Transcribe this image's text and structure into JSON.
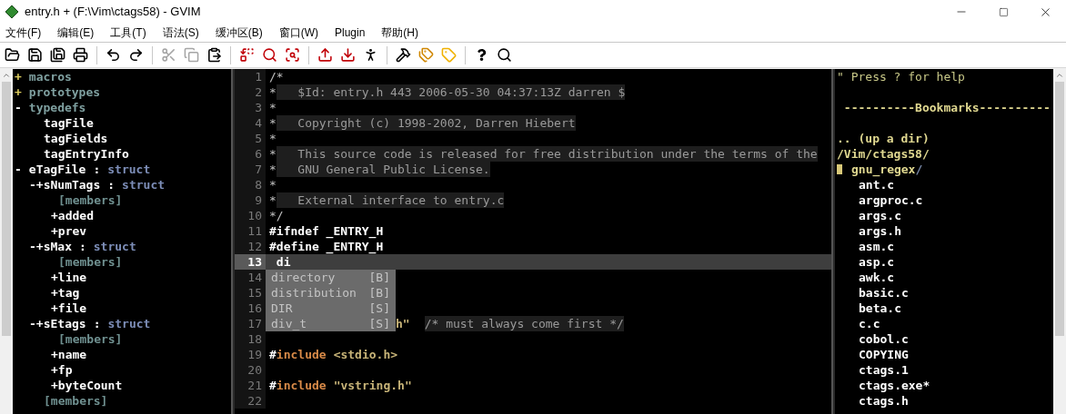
{
  "window": {
    "title": "entry.h + (F:\\Vim\\ctags58) - GVIM"
  },
  "menu": [
    "文件(F)",
    "编辑(E)",
    "工具(T)",
    "语法(S)",
    "缓冲区(B)",
    "窗口(W)",
    "Plugin",
    "帮助(H)"
  ],
  "toolbar": [
    {
      "kind": "open",
      "disabled": false
    },
    {
      "kind": "save",
      "disabled": false
    },
    {
      "kind": "saveall",
      "disabled": false
    },
    {
      "kind": "print",
      "disabled": false
    },
    {
      "kind": "separator"
    },
    {
      "kind": "undo",
      "disabled": false
    },
    {
      "kind": "redo",
      "disabled": false
    },
    {
      "kind": "separator"
    },
    {
      "kind": "cut",
      "disabled": true
    },
    {
      "kind": "copy",
      "disabled": true
    },
    {
      "kind": "paste",
      "disabled": false
    },
    {
      "kind": "separator"
    },
    {
      "kind": "replace",
      "disabled": false
    },
    {
      "kind": "findnext",
      "disabled": false
    },
    {
      "kind": "findprev",
      "disabled": false
    },
    {
      "kind": "separator"
    },
    {
      "kind": "loadsession",
      "disabled": false
    },
    {
      "kind": "savesession",
      "disabled": false
    },
    {
      "kind": "runscript",
      "disabled": false
    },
    {
      "kind": "separator"
    },
    {
      "kind": "make",
      "disabled": false
    },
    {
      "kind": "tagjump",
      "disabled": false
    },
    {
      "kind": "tag",
      "disabled": false
    },
    {
      "kind": "separator"
    },
    {
      "kind": "help",
      "disabled": false
    },
    {
      "kind": "findhelp",
      "disabled": false
    }
  ],
  "taglist": [
    {
      "kind": "group",
      "sign": "+",
      "expanded": false,
      "name": "macros"
    },
    {
      "kind": "group",
      "sign": "+",
      "expanded": false,
      "name": "prototypes"
    },
    {
      "kind": "group",
      "sign": "-",
      "expanded": true,
      "name": "typedefs",
      "children": [
        {
          "kind": "entry",
          "name": "tagFile"
        },
        {
          "kind": "entry",
          "name": "tagFields"
        },
        {
          "kind": "entry",
          "name": "tagEntryInfo"
        }
      ]
    },
    {
      "kind": "entry",
      "sign": "-",
      "expanded": true,
      "name": "eTagFile",
      "sep": ":",
      "type": "struct",
      "children": [
        {
          "kind": "entry",
          "sign": "-+",
          "expanded": true,
          "name": "sNumTags",
          "sep": ":",
          "type": "struct",
          "children": [
            {
              "kind": "members",
              "name": "[members]"
            },
            {
              "kind": "entry",
              "name": "+added"
            },
            {
              "kind": "entry",
              "name": "+prev"
            }
          ]
        },
        {
          "kind": "entry",
          "sign": "-+",
          "expanded": true,
          "name": "sMax",
          "sep": ":",
          "type": "struct",
          "children": [
            {
              "kind": "members",
              "name": "[members]"
            },
            {
              "kind": "entry",
              "name": "+line"
            },
            {
              "kind": "entry",
              "name": "+tag"
            },
            {
              "kind": "entry",
              "name": "+file"
            }
          ]
        },
        {
          "kind": "entry",
          "sign": "-+",
          "expanded": true,
          "name": "sEtags",
          "sep": ":",
          "type": "struct",
          "children": [
            {
              "kind": "members",
              "name": "[members]"
            },
            {
              "kind": "entry",
              "name": "+name"
            },
            {
              "kind": "entry",
              "name": "+fp"
            },
            {
              "kind": "entry",
              "name": "+byteCount"
            }
          ]
        },
        {
          "kind": "members",
          "name": "[members]"
        }
      ]
    }
  ],
  "code": [
    {
      "num": "1",
      "current": false,
      "segments": [
        {
          "kind": "mark",
          "text": "/*"
        }
      ]
    },
    {
      "num": "2",
      "current": false,
      "segments": [
        {
          "kind": "mark",
          "text": "*"
        },
        {
          "kind": "comment",
          "text": "   $Id: entry.h 443 2006-05-30 04:37:13Z darren $"
        }
      ]
    },
    {
      "num": "3",
      "current": false,
      "segments": [
        {
          "kind": "mark",
          "text": "*"
        }
      ]
    },
    {
      "num": "4",
      "current": false,
      "segments": [
        {
          "kind": "mark",
          "text": "*"
        },
        {
          "kind": "comment",
          "text": "   Copyright (c) 1998-2002, Darren Hiebert"
        }
      ]
    },
    {
      "num": "5",
      "current": false,
      "segments": [
        {
          "kind": "mark",
          "text": "*"
        }
      ]
    },
    {
      "num": "6",
      "current": false,
      "segments": [
        {
          "kind": "mark",
          "text": "*"
        },
        {
          "kind": "comment",
          "text": "   This source code is released for free distribution under the terms of the"
        }
      ]
    },
    {
      "num": "7",
      "current": false,
      "segments": [
        {
          "kind": "mark",
          "text": "*"
        },
        {
          "kind": "comment",
          "text": "   GNU General Public License."
        }
      ]
    },
    {
      "num": "8",
      "current": false,
      "segments": [
        {
          "kind": "mark",
          "text": "*"
        }
      ]
    },
    {
      "num": "9",
      "current": false,
      "segments": [
        {
          "kind": "mark",
          "text": "*"
        },
        {
          "kind": "comment",
          "text": "   External interface to entry.c"
        }
      ]
    },
    {
      "num": "10",
      "current": false,
      "segments": [
        {
          "kind": "mark",
          "text": "*/"
        }
      ]
    },
    {
      "num": "11",
      "current": false,
      "segments": [
        {
          "kind": "preproc",
          "text": "#ifndef _ENTRY_H"
        }
      ]
    },
    {
      "num": "12",
      "current": false,
      "segments": [
        {
          "kind": "preproc",
          "text": "#define _ENTRY_H"
        }
      ]
    },
    {
      "num": "13",
      "current": true,
      "segments": [
        {
          "kind": "typed",
          "text": " di"
        }
      ]
    },
    {
      "num": "14",
      "current": false
    },
    {
      "num": "15",
      "current": false
    },
    {
      "num": "16",
      "current": false
    },
    {
      "num": "17",
      "current": false,
      "segments": [
        {
          "kind": "string",
          "text": "h\""
        },
        {
          "kind": "comment",
          "text": "/* must always come first */"
        }
      ]
    },
    {
      "num": "18",
      "current": false
    },
    {
      "num": "19",
      "current": false,
      "segments": [
        {
          "kind": "hash",
          "text": "#"
        },
        {
          "kind": "keyword",
          "text": "include"
        },
        {
          "kind": "string",
          "text": "<stdio.h>"
        }
      ]
    },
    {
      "num": "20",
      "current": false
    },
    {
      "num": "21",
      "current": false,
      "segments": [
        {
          "kind": "hash",
          "text": "#"
        },
        {
          "kind": "keyword",
          "text": "include"
        },
        {
          "kind": "string",
          "text": "\"vstring.h\""
        }
      ]
    },
    {
      "num": "22",
      "current": false
    }
  ],
  "completion": {
    "items": [
      {
        "word": "directory",
        "tag": "[B]",
        "selected": false
      },
      {
        "word": "distribution",
        "tag": "[B]",
        "selected": false
      },
      {
        "word": "DIR",
        "tag": "[S]",
        "selected": false
      },
      {
        "word": "div_t",
        "tag": "[S]",
        "selected": false
      }
    ]
  },
  "explorer": [
    {
      "kind": "help",
      "text": "\" Press ? for help"
    },
    {
      "kind": "heading",
      "text": " ----------Bookmarks----------"
    },
    {
      "kind": "updir",
      "text": ".. (up a dir)"
    },
    {
      "kind": "path",
      "text": "/Vim/ctags58/"
    },
    {
      "kind": "dir",
      "text": "gnu_regex",
      "slash": "/"
    },
    {
      "kind": "file",
      "text": "ant.c"
    },
    {
      "kind": "file",
      "text": "argproc.c"
    },
    {
      "kind": "file",
      "text": "args.c"
    },
    {
      "kind": "file",
      "text": "args.h"
    },
    {
      "kind": "file",
      "text": "asm.c"
    },
    {
      "kind": "file",
      "text": "asp.c"
    },
    {
      "kind": "file",
      "text": "awk.c"
    },
    {
      "kind": "file",
      "text": "basic.c"
    },
    {
      "kind": "file",
      "text": "beta.c"
    },
    {
      "kind": "file",
      "text": "c.c"
    },
    {
      "kind": "file",
      "text": "cobol.c"
    },
    {
      "kind": "file",
      "text": "COPYING"
    },
    {
      "kind": "file",
      "text": "ctags.1"
    },
    {
      "kind": "file",
      "text": "ctags.exe*"
    },
    {
      "kind": "file",
      "text": "ctags.h"
    }
  ]
}
